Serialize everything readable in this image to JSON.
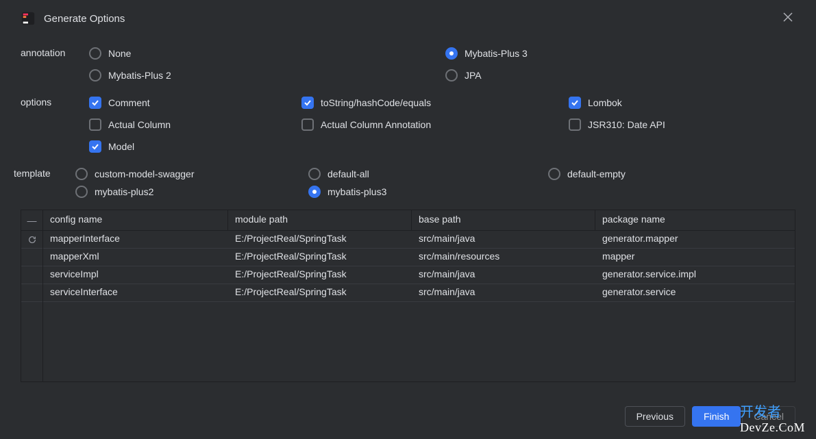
{
  "dialog": {
    "title": "Generate Options"
  },
  "annotation": {
    "label": "annotation",
    "none": "None",
    "mp2": "Mybatis-Plus 2",
    "mp3": "Mybatis-Plus 3",
    "jpa": "JPA",
    "selected": "mp3"
  },
  "options": {
    "label": "options",
    "comment": {
      "label": "Comment",
      "checked": true
    },
    "tostring": {
      "label": "toString/hashCode/equals",
      "checked": true
    },
    "lombok": {
      "label": "Lombok",
      "checked": true
    },
    "actualColumn": {
      "label": "Actual Column",
      "checked": false
    },
    "actualColumnAnno": {
      "label": "Actual Column Annotation",
      "checked": false
    },
    "jsr310": {
      "label": "JSR310: Date API",
      "checked": false
    },
    "model": {
      "label": "Model",
      "checked": true
    }
  },
  "template": {
    "label": "template",
    "customSwagger": "custom-model-swagger",
    "defaultAll": "default-all",
    "defaultEmpty": "default-empty",
    "mp2": "mybatis-plus2",
    "mp3": "mybatis-plus3",
    "selected": "mp3"
  },
  "table": {
    "headers": {
      "configName": "config name",
      "modulePath": "module path",
      "basePath": "base path",
      "packageName": "package name"
    },
    "gutterCollapse": "—",
    "rows": [
      {
        "configName": "mapperInterface",
        "modulePath": "E:/ProjectReal/SpringTask",
        "basePath": "src/main/java",
        "packageName": "generator.mapper",
        "refresh": true
      },
      {
        "configName": "mapperXml",
        "modulePath": "E:/ProjectReal/SpringTask",
        "basePath": "src/main/resources",
        "packageName": "mapper",
        "refresh": false
      },
      {
        "configName": "serviceImpl",
        "modulePath": "E:/ProjectReal/SpringTask",
        "basePath": "src/main/java",
        "packageName": "generator.service.impl",
        "refresh": false
      },
      {
        "configName": "serviceInterface",
        "modulePath": "E:/ProjectReal/SpringTask",
        "basePath": "src/main/java",
        "packageName": "generator.service",
        "refresh": false
      }
    ]
  },
  "footer": {
    "previous": "Previous",
    "finish": "Finish",
    "cancel": "Cancel"
  },
  "watermark": {
    "cn": "开发者",
    "en": "DevZe.CoM"
  }
}
